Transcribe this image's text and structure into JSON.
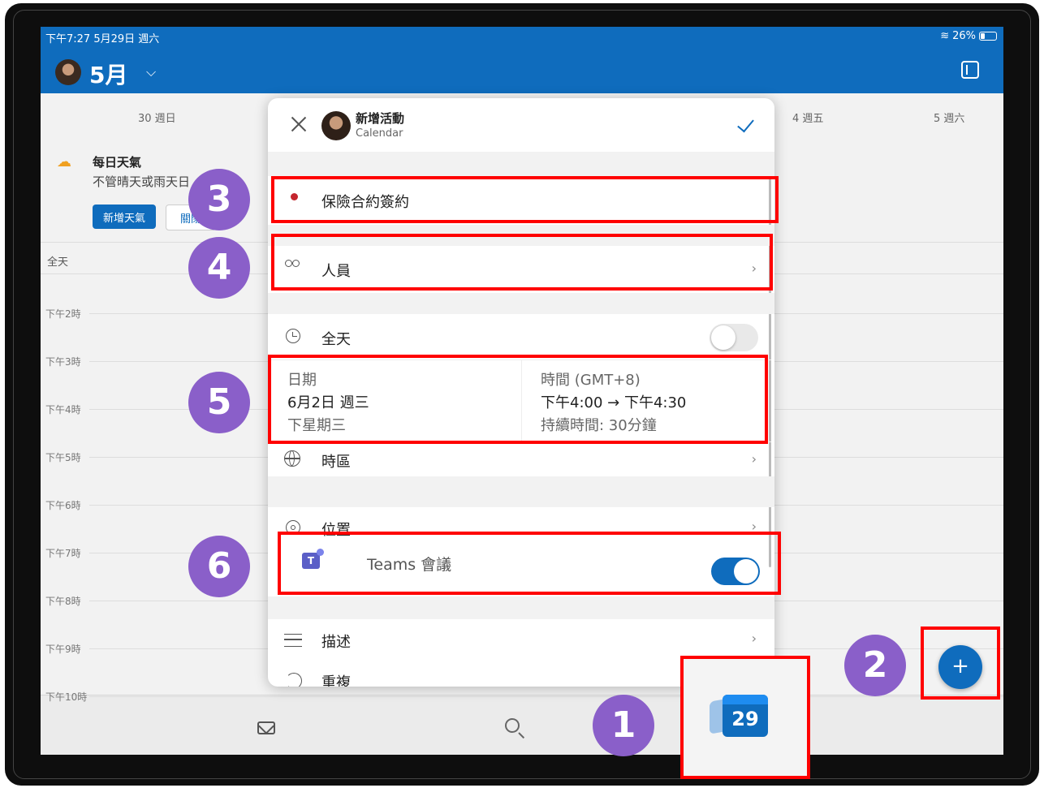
{
  "status_bar": {
    "time_date": "下午7:27  5月29日 週六",
    "battery": "26%"
  },
  "header": {
    "month": "5月"
  },
  "days": {
    "sun": "30 週日",
    "thu": "4 週五",
    "sat": "5 週六"
  },
  "weather": {
    "title": "每日天氣",
    "desc": "不管晴天或雨天",
    "desc_tail": "日",
    "add_btn": "新增天氣",
    "close_btn": "關閉"
  },
  "calendar": {
    "allday": "全天",
    "hours": [
      "下午2時",
      "下午3時",
      "下午4時",
      "下午5時",
      "下午6時",
      "下午7時",
      "下午8時",
      "下午9時",
      "下午10時"
    ]
  },
  "modal": {
    "title": "新增活動",
    "subtitle": "Calendar",
    "event_title": "保險合約簽約",
    "people": "人員",
    "all_day": "全天",
    "date_label": "日期",
    "date_value": "6月2日 週三",
    "date_relative": "下星期三",
    "time_label": "時間 (GMT+8)",
    "time_value": "下午4:00 → 下午4:30",
    "duration": "持續時間: 30分鐘",
    "timezone": "時區",
    "location": "位置",
    "teams": "Teams 會議",
    "description": "描述",
    "repeat": "重複",
    "teams_icon_letter": "T",
    "chevron": "›"
  },
  "app_icon_date": "29",
  "fab_label": "+",
  "markers": [
    "1",
    "2",
    "3",
    "4",
    "5",
    "6"
  ],
  "colors": {
    "accent": "#0f6cbd",
    "highlight": "#ff0000",
    "marker": "#8a5fc9",
    "event_dot": "#c4262e"
  }
}
